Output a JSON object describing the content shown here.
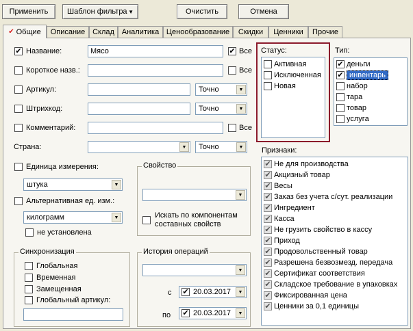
{
  "toolbar": {
    "apply": "Применить",
    "template": "Шаблон фильтра",
    "clear": "Очистить",
    "cancel": "Отмена"
  },
  "tabs": [
    "Общие",
    "Описание",
    "Склад",
    "Аналитика",
    "Ценообразование",
    "Скидки",
    "Ценники",
    "Прочие"
  ],
  "fields": {
    "name_label": "Название:",
    "name_value": "Мясо",
    "all_label": "Все",
    "short_label": "Короткое назв.:",
    "article_label": "Артикул:",
    "article_mode": "Точно",
    "barcode_label": "Штрихкод:",
    "barcode_mode": "Точно",
    "comment_label": "Комментарий:",
    "country_label": "Страна:",
    "country_mode": "Точно",
    "unit_label": "Единица измерения:",
    "unit_value": "штука",
    "alt_unit_label": "Альтернативная ед. изм.:",
    "alt_unit_value": "килограмм",
    "not_set_label": "не установлена"
  },
  "property": {
    "title": "Свойство",
    "search_components": "Искать по компонентам составных свойств"
  },
  "sync": {
    "title": "Синхронизация",
    "items": [
      "Глобальная",
      "Временная",
      "Замещенная",
      "Глобальный артикул:"
    ]
  },
  "history": {
    "title": "История операций",
    "from_label": "с",
    "from_date": "20.03.2017",
    "to_label": "по",
    "to_date": "20.03.2017"
  },
  "status": {
    "title": "Статус:",
    "items": [
      "Активная",
      "Исключенная",
      "Новая"
    ],
    "highlight_color": "#8b1a2b"
  },
  "type": {
    "title": "Тип:",
    "items": [
      {
        "label": "деньги",
        "checked": true
      },
      {
        "label": "инвентарь",
        "checked": true,
        "selected": true
      },
      {
        "label": "набор",
        "checked": false
      },
      {
        "label": "тара",
        "checked": false
      },
      {
        "label": "товар",
        "checked": false
      },
      {
        "label": "услуга",
        "checked": false
      }
    ]
  },
  "attributes": {
    "title": "Признаки:",
    "items": [
      "Не для производства",
      "Акцизный товар",
      "Весы",
      "Заказ без учета с/сут. реализации",
      "Ингредиент",
      "Касса",
      "Не грузить свойство в кассу",
      "Приход",
      "Продовольственный товар",
      "Разрешена безвозмезд. передача",
      "Сертификат соответствия",
      "Складское требование в упаковках",
      "Фиксированная цена",
      "Ценники за 0,1 единицы"
    ]
  },
  "icons": {
    "check": "✔",
    "dropdown": "▼"
  }
}
